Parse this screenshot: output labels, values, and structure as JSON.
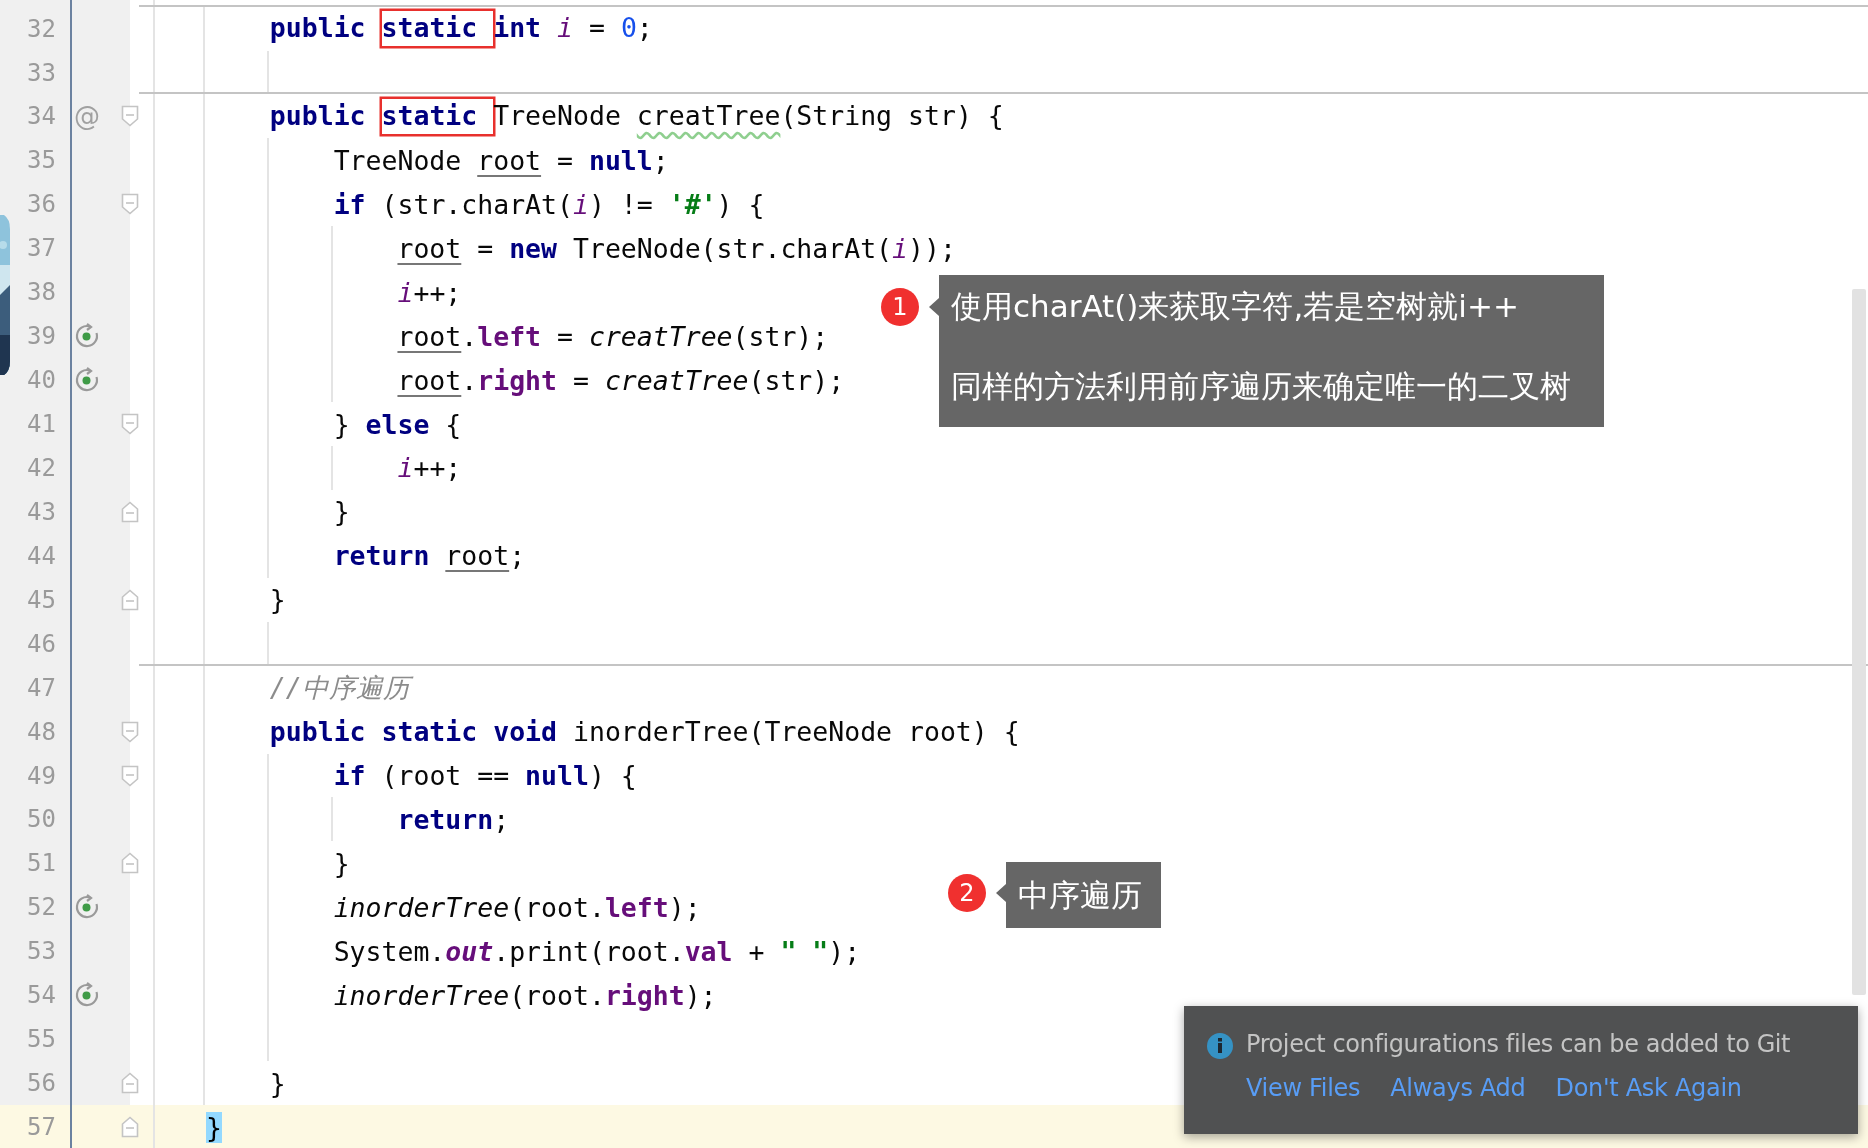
{
  "editor": {
    "lines": [
      {
        "number": "32",
        "separator": true,
        "current": false,
        "tokens": [
          {
            "text": "    public ",
            "kind": "keyword"
          },
          {
            "text": "static ",
            "kind": "boxed-keyword"
          },
          {
            "text": "int ",
            "kind": "keyword"
          },
          {
            "text": "i",
            "kind": "static-field"
          },
          {
            "text": " = ",
            "kind": "plain"
          },
          {
            "text": "0",
            "kind": "number"
          },
          {
            "text": ";",
            "kind": "plain"
          }
        ]
      },
      {
        "number": "33",
        "separator": false,
        "current": false
      },
      {
        "number": "34",
        "separator": true,
        "current": false,
        "gutter_mark": {
          "kind": "text",
          "text": "@"
        },
        "fold": {
          "kind": "start"
        },
        "tokens": [
          {
            "text": "    public ",
            "kind": "keyword"
          },
          {
            "text": "static ",
            "kind": "boxed-keyword"
          },
          {
            "text": "TreeNode ",
            "kind": "plain"
          },
          {
            "text": "creatTree",
            "kind": "warning"
          },
          {
            "text": "(String str) {",
            "kind": "plain"
          }
        ]
      },
      {
        "number": "35",
        "separator": false,
        "current": false,
        "tokens": [
          {
            "text": "        TreeNode ",
            "kind": "plain"
          },
          {
            "text": "root",
            "kind": "reassigned"
          },
          {
            "text": " = ",
            "kind": "plain"
          },
          {
            "text": "null",
            "kind": "keyword"
          },
          {
            "text": ";",
            "kind": "plain"
          }
        ]
      },
      {
        "number": "36",
        "separator": false,
        "current": false,
        "fold": {
          "kind": "start"
        },
        "tokens": [
          {
            "text": "        if",
            "kind": "keyword"
          },
          {
            "text": " (str.charAt(",
            "kind": "plain"
          },
          {
            "text": "i",
            "kind": "static-field"
          },
          {
            "text": ") != ",
            "kind": "plain"
          },
          {
            "text": "'#'",
            "kind": "string"
          },
          {
            "text": ") {",
            "kind": "plain"
          }
        ]
      },
      {
        "number": "37",
        "separator": false,
        "current": false,
        "tokens": [
          {
            "text": "            root",
            "kind": "reassigned"
          },
          {
            "text": " = ",
            "kind": "plain"
          },
          {
            "text": "new",
            "kind": "keyword"
          },
          {
            "text": " TreeNode(str.charAt(",
            "kind": "plain"
          },
          {
            "text": "i",
            "kind": "static-field"
          },
          {
            "text": "));",
            "kind": "plain"
          }
        ]
      },
      {
        "number": "38",
        "separator": false,
        "current": false,
        "tokens": [
          {
            "text": "            i",
            "kind": "static-field"
          },
          {
            "text": "++;",
            "kind": "plain"
          }
        ]
      },
      {
        "number": "39",
        "separator": false,
        "current": false,
        "gutter_mark": {
          "kind": "recursion"
        },
        "tokens": [
          {
            "text": "            root",
            "kind": "reassigned"
          },
          {
            "text": ".",
            "kind": "plain"
          },
          {
            "text": "left",
            "kind": "field"
          },
          {
            "text": " = ",
            "kind": "plain"
          },
          {
            "text": "creatTree",
            "kind": "static-call"
          },
          {
            "text": "(str);",
            "kind": "plain"
          }
        ]
      },
      {
        "number": "40",
        "separator": false,
        "current": false,
        "gutter_mark": {
          "kind": "recursion"
        },
        "tokens": [
          {
            "text": "            root",
            "kind": "reassigned"
          },
          {
            "text": ".",
            "kind": "plain"
          },
          {
            "text": "right",
            "kind": "field"
          },
          {
            "text": " = ",
            "kind": "plain"
          },
          {
            "text": "creatTree",
            "kind": "static-call"
          },
          {
            "text": "(str);",
            "kind": "plain"
          }
        ]
      },
      {
        "number": "41",
        "separator": false,
        "current": false,
        "fold": {
          "kind": "start"
        },
        "tokens": [
          {
            "text": "        } ",
            "kind": "plain"
          },
          {
            "text": "else",
            "kind": "keyword"
          },
          {
            "text": " {",
            "kind": "plain"
          }
        ]
      },
      {
        "number": "42",
        "separator": false,
        "current": false,
        "tokens": [
          {
            "text": "            i",
            "kind": "static-field"
          },
          {
            "text": "++;",
            "kind": "plain"
          }
        ]
      },
      {
        "number": "43",
        "separator": false,
        "current": false,
        "fold": {
          "kind": "end"
        },
        "tokens": [
          {
            "text": "        }",
            "kind": "plain"
          }
        ]
      },
      {
        "number": "44",
        "separator": false,
        "current": false,
        "tokens": [
          {
            "text": "        return ",
            "kind": "keyword"
          },
          {
            "text": "root",
            "kind": "reassigned"
          },
          {
            "text": ";",
            "kind": "plain"
          }
        ]
      },
      {
        "number": "45",
        "separator": false,
        "current": false,
        "fold": {
          "kind": "end"
        },
        "tokens": [
          {
            "text": "    }",
            "kind": "plain"
          }
        ]
      },
      {
        "number": "46",
        "separator": false,
        "current": false
      },
      {
        "number": "47",
        "separator": true,
        "current": false,
        "tokens": [
          {
            "text": "    //中序遍历",
            "kind": "comment"
          }
        ]
      },
      {
        "number": "48",
        "separator": false,
        "current": false,
        "fold": {
          "kind": "start"
        },
        "tokens": [
          {
            "text": "    public static void",
            "kind": "keyword"
          },
          {
            "text": " inorderTree(TreeNode root) {",
            "kind": "plain"
          }
        ]
      },
      {
        "number": "49",
        "separator": false,
        "current": false,
        "fold": {
          "kind": "start"
        },
        "tokens": [
          {
            "text": "        if",
            "kind": "keyword"
          },
          {
            "text": " (root == ",
            "kind": "plain"
          },
          {
            "text": "null",
            "kind": "keyword"
          },
          {
            "text": ") {",
            "kind": "plain"
          }
        ]
      },
      {
        "number": "50",
        "separator": false,
        "current": false,
        "tokens": [
          {
            "text": "            return",
            "kind": "keyword"
          },
          {
            "text": ";",
            "kind": "plain"
          }
        ]
      },
      {
        "number": "51",
        "separator": false,
        "current": false,
        "fold": {
          "kind": "end"
        },
        "tokens": [
          {
            "text": "        }",
            "kind": "plain"
          }
        ]
      },
      {
        "number": "52",
        "separator": false,
        "current": false,
        "gutter_mark": {
          "kind": "recursion"
        },
        "tokens": [
          {
            "text": "        inorderTree",
            "kind": "static-call"
          },
          {
            "text": "(root.",
            "kind": "plain"
          },
          {
            "text": "left",
            "kind": "field"
          },
          {
            "text": ");",
            "kind": "plain"
          }
        ]
      },
      {
        "number": "53",
        "separator": false,
        "current": false,
        "tokens": [
          {
            "text": "        System.",
            "kind": "plain"
          },
          {
            "text": "out",
            "kind": "static-constant"
          },
          {
            "text": ".print(root.",
            "kind": "plain"
          },
          {
            "text": "val",
            "kind": "field"
          },
          {
            "text": " + ",
            "kind": "plain"
          },
          {
            "text": "\" \"",
            "kind": "string"
          },
          {
            "text": ");",
            "kind": "plain"
          }
        ]
      },
      {
        "number": "54",
        "separator": false,
        "current": false,
        "gutter_mark": {
          "kind": "recursion"
        },
        "tokens": [
          {
            "text": "        inorderTree",
            "kind": "static-call"
          },
          {
            "text": "(root.",
            "kind": "plain"
          },
          {
            "text": "right",
            "kind": "field"
          },
          {
            "text": ");",
            "kind": "plain"
          }
        ]
      },
      {
        "number": "55",
        "separator": false,
        "current": false
      },
      {
        "number": "56",
        "separator": false,
        "current": false,
        "fold": {
          "kind": "end"
        },
        "tokens": [
          {
            "text": "    }",
            "kind": "plain"
          }
        ]
      },
      {
        "number": "57",
        "separator": false,
        "current": true,
        "fold": {
          "kind": "end"
        },
        "tokens": [
          {
            "text": "}",
            "kind": "brace-match"
          }
        ]
      }
    ]
  },
  "callouts": [
    {
      "number": "1",
      "lines": [
        "使用charAt()来获取字符,若是空树就i++",
        "同样的方法利用前序遍历来确定唯一的二叉树"
      ]
    },
    {
      "number": "2",
      "lines": [
        "中序遍历"
      ]
    }
  ],
  "notification": {
    "message": "Project configurations files can be added to Git",
    "actions": [
      "View Files",
      "Always Add",
      "Don't Ask Again"
    ]
  }
}
